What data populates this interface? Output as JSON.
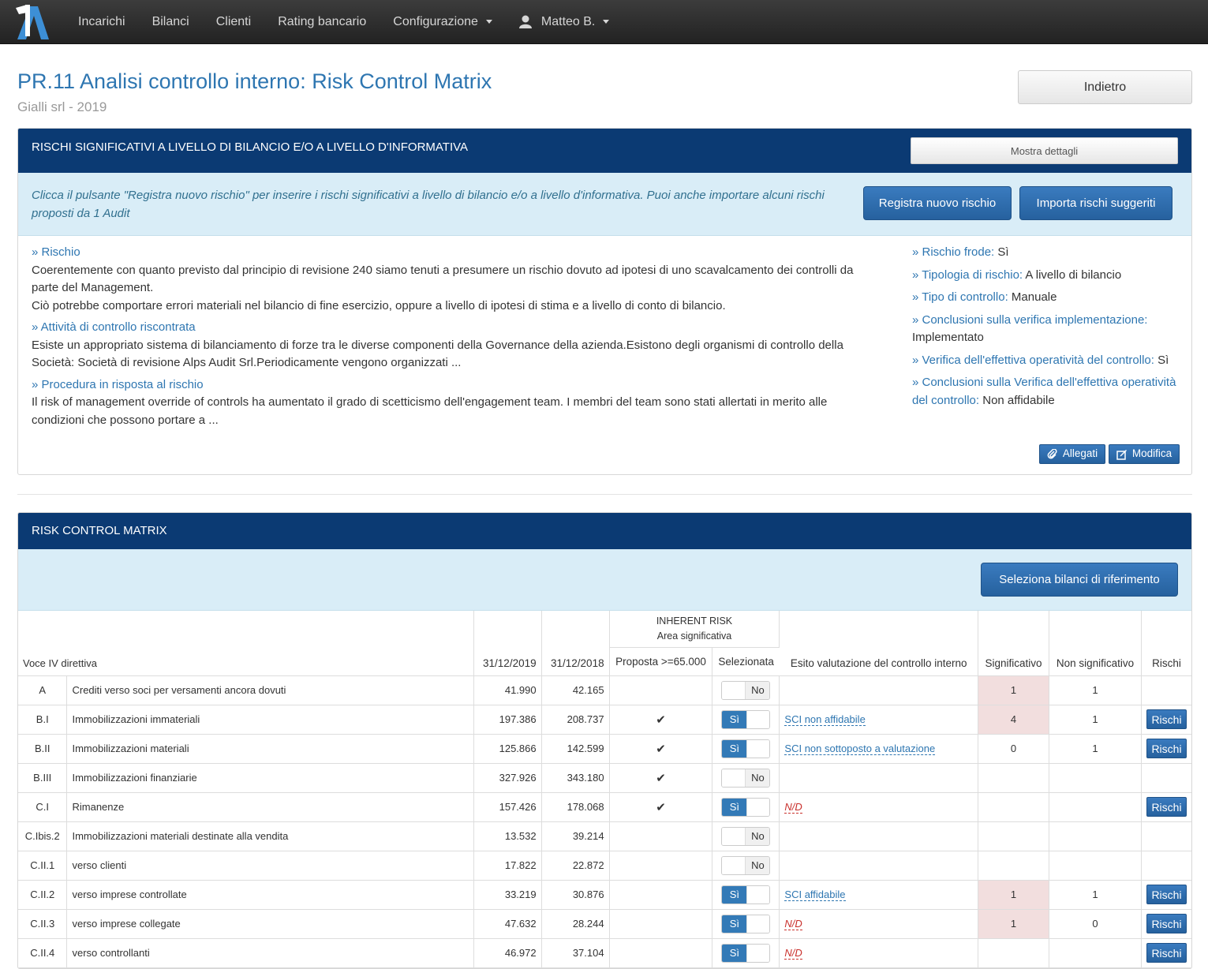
{
  "nav": {
    "logo_letter": "A",
    "items": [
      "Incarichi",
      "Bilanci",
      "Clienti",
      "Rating bancario",
      "Configurazione"
    ],
    "user": "Matteo B."
  },
  "header": {
    "title": "PR.11 Analisi controllo interno: Risk Control Matrix",
    "subtitle": "Gialli srl - 2019",
    "back_label": "Indietro"
  },
  "risk_panel": {
    "heading": "RISCHI SIGNIFICATIVI A LIVELLO DI BILANCIO E/O A LIVELLO D'INFORMATIVA",
    "details_label": "Mostra dettagli",
    "info": "Clicca il pulsante \"Registra nuovo rischio\" per inserire i rischi significativi a livello di bilancio e/o a livello d'informativa. Puoi anche importare alcuni rischi proposti da 1 Audit",
    "new_label": "Registra nuovo rischio",
    "import_label": "Importa rischi suggeriti",
    "rischio_label": "» Rischio",
    "rischio_text_1": "Coerentemente con quanto previsto dal principio di revisione 240 siamo tenuti a presumere un rischio dovuto ad ipotesi di uno scavalcamento dei controlli da parte del Management.",
    "rischio_text_2": "Ciò potrebbe comportare errori materiali nel bilancio di fine esercizio, oppure a livello di ipotesi di stima e a livello di conto di bilancio.",
    "attivita_label": "» Attività di controllo riscontrata",
    "attivita_text": "Esiste un appropriato sistema di bilanciamento di forze tra le diverse componenti della Governance della azienda.Esistono degli organismi di controllo della Società: Società di revisione Alps Audit Srl.Periodicamente vengono organizzati ...",
    "procedura_label": "» Procedura in risposta al rischio",
    "procedura_text": "Il risk of management override of controls ha aumentato il grado di scetticismo dell'engagement team. I membri del team sono stati allertati in merito alle condizioni che possono portare a ...",
    "right": [
      {
        "label": "» Rischio frode:",
        "value": "Sì"
      },
      {
        "label": "» Tipologia di rischio:",
        "value": "A livello di bilancio"
      },
      {
        "label": "» Tipo di controllo:",
        "value": "Manuale"
      },
      {
        "label": "» Conclusioni sulla verifica implementazione:",
        "value": "Implementato"
      },
      {
        "label": "» Verifica dell'effettiva operatività del controllo:",
        "value": "Sì"
      },
      {
        "label": "» Conclusioni sulla Verifica dell'effettiva operatività del controllo:",
        "value": "Non affidabile"
      }
    ],
    "allegati_label": "Allegati",
    "modifica_label": "Modifica"
  },
  "rcm_panel": {
    "heading": "RISK CONTROL MATRIX",
    "select_label": "Seleziona bilanci di riferimento",
    "headers": {
      "voce": "Voce IV direttiva",
      "y1": "31/12/2019",
      "y2": "31/12/2018",
      "inherent": "INHERENT RISK",
      "area": "Area significativa",
      "proposta": "Proposta >=65.000",
      "selezionata": "Selezionata",
      "esito": "Esito valutazione del controllo interno",
      "significativo": "Significativo",
      "non_significativo": "Non significativo",
      "rischi": "Rischi"
    },
    "rows": [
      {
        "code": "A",
        "desc": "Crediti verso soci per versamenti ancora dovuti",
        "y1": "41.990",
        "y2": "42.165",
        "proposta": false,
        "sel": "No",
        "esito": "",
        "esito_type": "",
        "sig": "1",
        "sig_pink": true,
        "nsig": "1",
        "rischi": ""
      },
      {
        "code": "B.I",
        "desc": "Immobilizzazioni immateriali",
        "y1": "197.386",
        "y2": "208.737",
        "proposta": true,
        "sel": "Sì",
        "esito": "SCI non affidabile",
        "esito_type": "link",
        "sig": "4",
        "sig_pink": true,
        "nsig": "1",
        "rischi": "Rischi"
      },
      {
        "code": "B.II",
        "desc": "Immobilizzazioni materiali",
        "y1": "125.866",
        "y2": "142.599",
        "proposta": true,
        "sel": "Sì",
        "esito": "SCI non sottoposto a valutazione",
        "esito_type": "link",
        "sig": "0",
        "sig_pink": false,
        "nsig": "1",
        "rischi": "Rischi"
      },
      {
        "code": "B.III",
        "desc": "Immobilizzazioni finanziarie",
        "y1": "327.926",
        "y2": "343.180",
        "proposta": true,
        "sel": "No",
        "esito": "",
        "esito_type": "",
        "sig": "",
        "sig_pink": false,
        "nsig": "",
        "rischi": ""
      },
      {
        "code": "C.I",
        "desc": "Rimanenze",
        "y1": "157.426",
        "y2": "178.068",
        "proposta": true,
        "sel": "Sì",
        "esito": "N/D",
        "esito_type": "nd",
        "sig": "",
        "sig_pink": false,
        "nsig": "",
        "rischi": "Rischi"
      },
      {
        "code": "C.Ibis.2",
        "desc": "Immobilizzazioni materiali destinate alla vendita",
        "y1": "13.532",
        "y2": "39.214",
        "proposta": false,
        "sel": "No",
        "esito": "",
        "esito_type": "",
        "sig": "",
        "sig_pink": false,
        "nsig": "",
        "rischi": ""
      },
      {
        "code": "C.II.1",
        "desc": "verso clienti",
        "y1": "17.822",
        "y2": "22.872",
        "proposta": false,
        "sel": "No",
        "esito": "",
        "esito_type": "",
        "sig": "",
        "sig_pink": false,
        "nsig": "",
        "rischi": ""
      },
      {
        "code": "C.II.2",
        "desc": "verso imprese controllate",
        "y1": "33.219",
        "y2": "30.876",
        "proposta": false,
        "sel": "Sì",
        "esito": "SCI affidabile",
        "esito_type": "link",
        "sig": "1",
        "sig_pink": true,
        "nsig": "1",
        "rischi": "Rischi"
      },
      {
        "code": "C.II.3",
        "desc": "verso imprese collegate",
        "y1": "47.632",
        "y2": "28.244",
        "proposta": false,
        "sel": "Sì",
        "esito": "N/D",
        "esito_type": "nd",
        "sig": "1",
        "sig_pink": true,
        "nsig": "0",
        "rischi": "Rischi"
      },
      {
        "code": "C.II.4",
        "desc": "verso controllanti",
        "y1": "46.972",
        "y2": "37.104",
        "proposta": false,
        "sel": "Sì",
        "esito": "N/D",
        "esito_type": "nd",
        "sig": "",
        "sig_pink": false,
        "nsig": "",
        "rischi": "Rischi"
      }
    ]
  }
}
